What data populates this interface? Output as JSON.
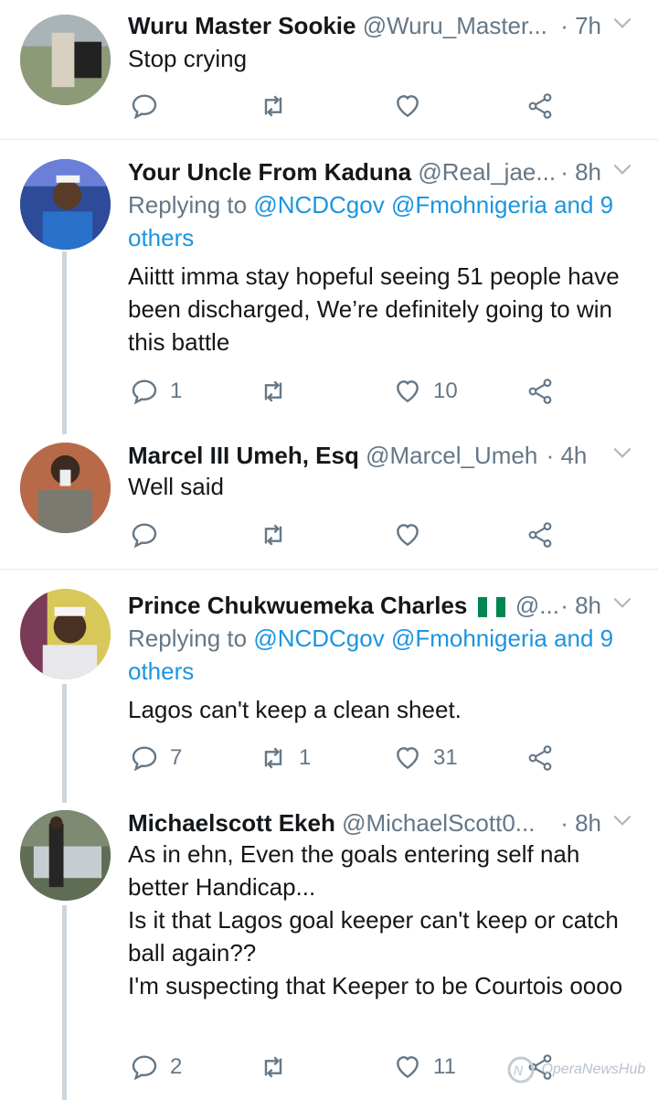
{
  "tweets": [
    {
      "name": "Wuru Master Sookie",
      "handle": "@Wuru_Master...",
      "time": "· 7h",
      "reply_prefix": "",
      "reply_mentions": "",
      "text": "Stop crying",
      "replies": "",
      "retweets": "",
      "likes": "",
      "avatar_color": "#7a8a66"
    },
    {
      "name": "Your Uncle From Kaduna",
      "handle": "@Real_jae...",
      "time": "· 8h",
      "reply_prefix": "Replying to",
      "reply_mentions": "@NCDCgov @Fmohnigeria and 9 others",
      "text": "Aiittt imma stay hopeful seeing 51 people have been discharged, We’re definitely going to win this battle",
      "replies": "1",
      "retweets": "",
      "likes": "10",
      "avatar_color": "#3b5aa8"
    },
    {
      "name": "Marcel III Umeh, Esq",
      "handle": "@Marcel_Umeh",
      "time": "· 4h",
      "reply_prefix": "",
      "reply_mentions": "",
      "text": "Well said",
      "replies": "",
      "retweets": "",
      "likes": "",
      "avatar_color": "#b25a3a"
    },
    {
      "name": "Prince Chukwuemeka Charles",
      "handle": "@...",
      "time": "· 8h",
      "reply_prefix": "Replying to",
      "reply_mentions": "@NCDCgov @Fmohnigeria and 9 others",
      "text": "Lagos can't keep a clean sheet.",
      "replies": "7",
      "retweets": "1",
      "likes": "31",
      "avatar_color": "#c9c24a"
    },
    {
      "name": "Michaelscott Ekeh",
      "handle": "@MichaelScott0...",
      "time": "· 8h",
      "reply_prefix": "",
      "reply_mentions": "",
      "text": "As in ehn, Even the goals entering self nah better Handicap...\nIs it that Lagos goal keeper can't keep or catch ball again??\nI'm suspecting that Keeper to be Courtois oooo",
      "replies": "2",
      "retweets": "",
      "likes": "11",
      "avatar_color": "#6f7b63"
    }
  ],
  "colors": {
    "name": "#14171a",
    "muted": "#657786",
    "link": "#1b95e0",
    "divider": "#e1e8ed",
    "thread_line": "#ccd6dd"
  },
  "watermark": "OperaNewsHub"
}
